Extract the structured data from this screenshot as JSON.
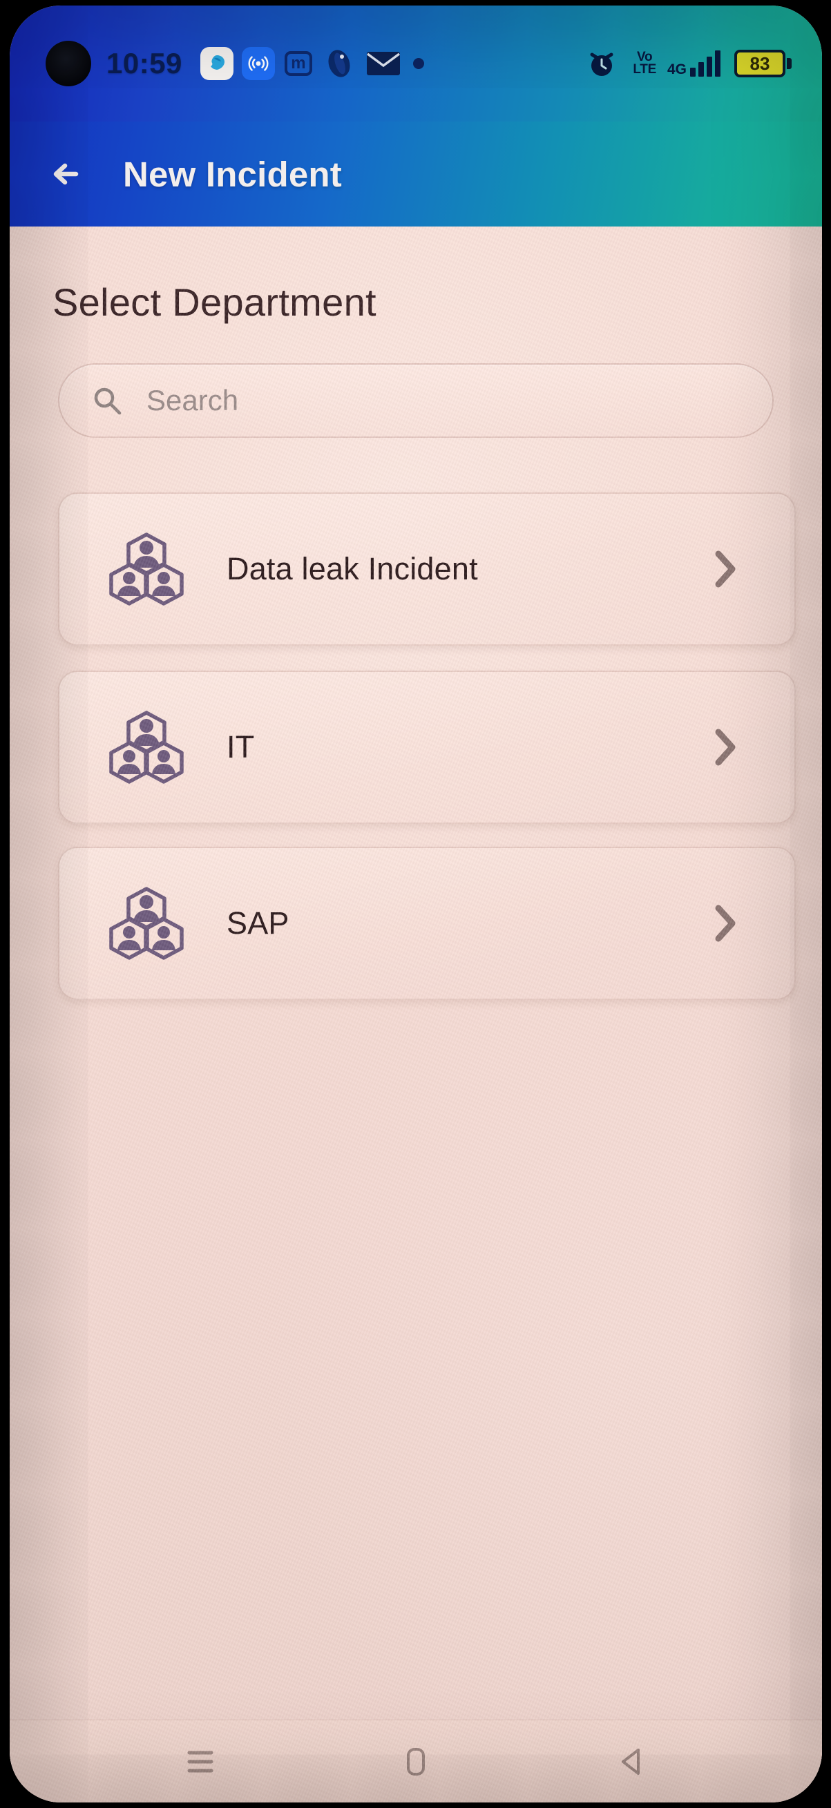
{
  "status_bar": {
    "time": "10:59",
    "icons_left": [
      {
        "name": "app-notification-icon",
        "glyph": "blob"
      },
      {
        "name": "broadcast-notification-icon",
        "glyph": "broadcast"
      },
      {
        "name": "m-app-notification-icon",
        "glyph": "m"
      },
      {
        "name": "opera-notification-icon",
        "glyph": "opera"
      },
      {
        "name": "mail-notification-icon",
        "glyph": "envelope"
      },
      {
        "name": "more-notifications-dot-icon",
        "glyph": "dot"
      }
    ],
    "alarm_icon": "alarm-clock-icon",
    "volte_line1": "Vo",
    "volte_line2": "LTE",
    "network_type": "4G",
    "signal_bars": 4,
    "battery_level": "83"
  },
  "app_bar": {
    "back_icon": "back-arrow-icon",
    "title": "New Incident"
  },
  "main": {
    "heading": "Select Department",
    "search": {
      "placeholder": "Search",
      "value": "",
      "icon": "search-icon"
    },
    "departments": [
      {
        "label": "Data leak Incident",
        "icon": "org-chart-icon",
        "chevron": "chevron-right-icon"
      },
      {
        "label": "IT",
        "icon": "org-chart-icon",
        "chevron": "chevron-right-icon"
      },
      {
        "label": "SAP",
        "icon": "org-chart-icon",
        "chevron": "chevron-right-icon"
      }
    ]
  },
  "nav_bar": {
    "recents_label": "Recents",
    "home_label": "Home",
    "back_label": "Back"
  },
  "colors": {
    "app_bar_start": "#1430bd",
    "app_bar_end": "#18b596",
    "content_bg": "#f5dbd3",
    "icon_purple": "#6d5a7c",
    "text_dark": "#2c1a1c",
    "battery_yellow": "#d9d62a"
  }
}
